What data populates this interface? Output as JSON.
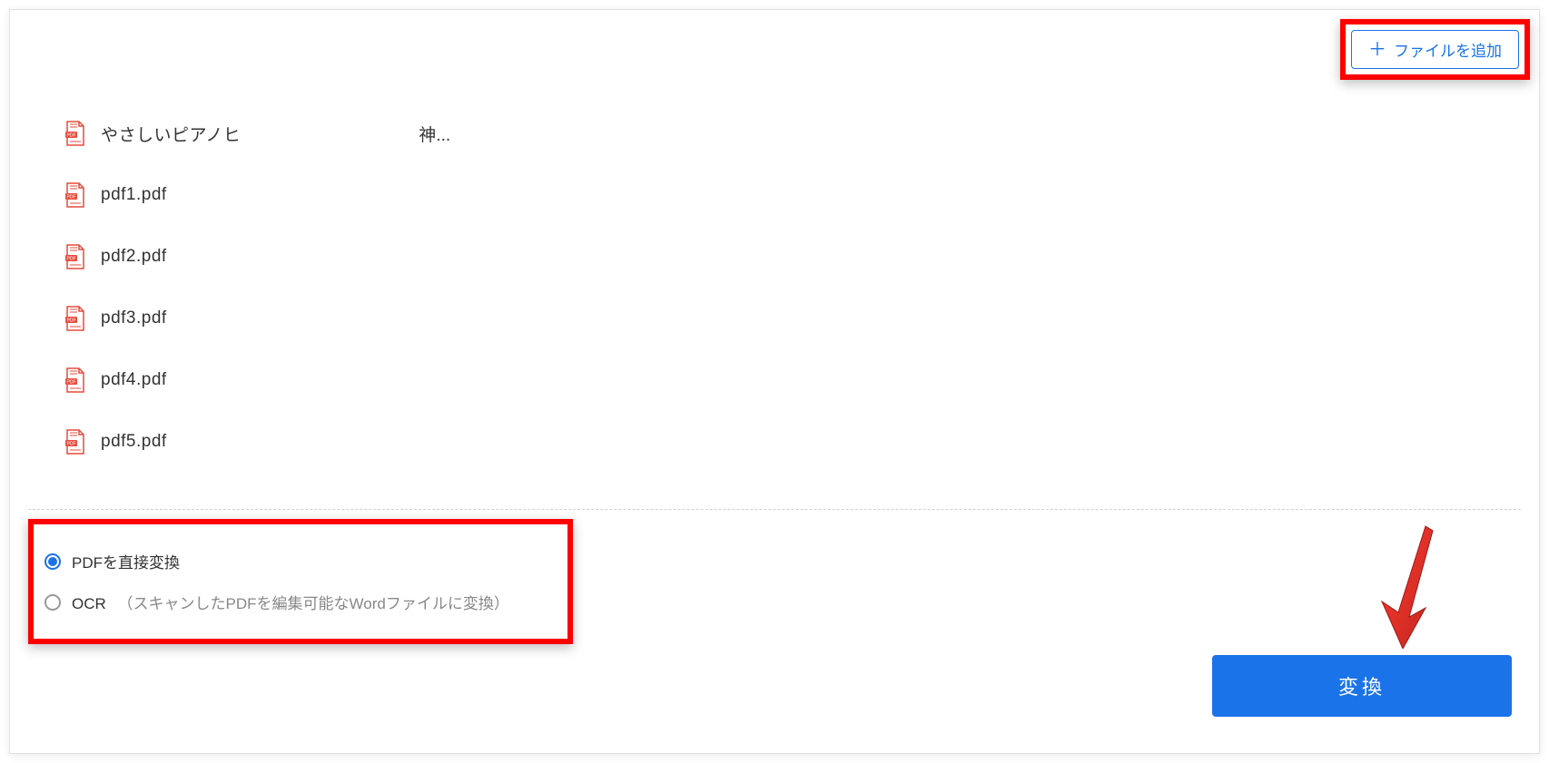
{
  "header": {
    "add_file_label": "ファイルを追加"
  },
  "files": [
    {
      "name": "やさしいピアノヒ",
      "suffix": "神..."
    },
    {
      "name": "pdf1.pdf",
      "suffix": ""
    },
    {
      "name": "pdf2.pdf",
      "suffix": ""
    },
    {
      "name": "pdf3.pdf",
      "suffix": ""
    },
    {
      "name": "pdf4.pdf",
      "suffix": ""
    },
    {
      "name": "pdf5.pdf",
      "suffix": ""
    }
  ],
  "options": {
    "direct_label": "PDFを直接変換",
    "ocr_label": "OCR",
    "ocr_detail": "（スキャンしたPDFを編集可能なWordファイルに変換）",
    "selected": "direct"
  },
  "footer": {
    "convert_label": "変換"
  }
}
